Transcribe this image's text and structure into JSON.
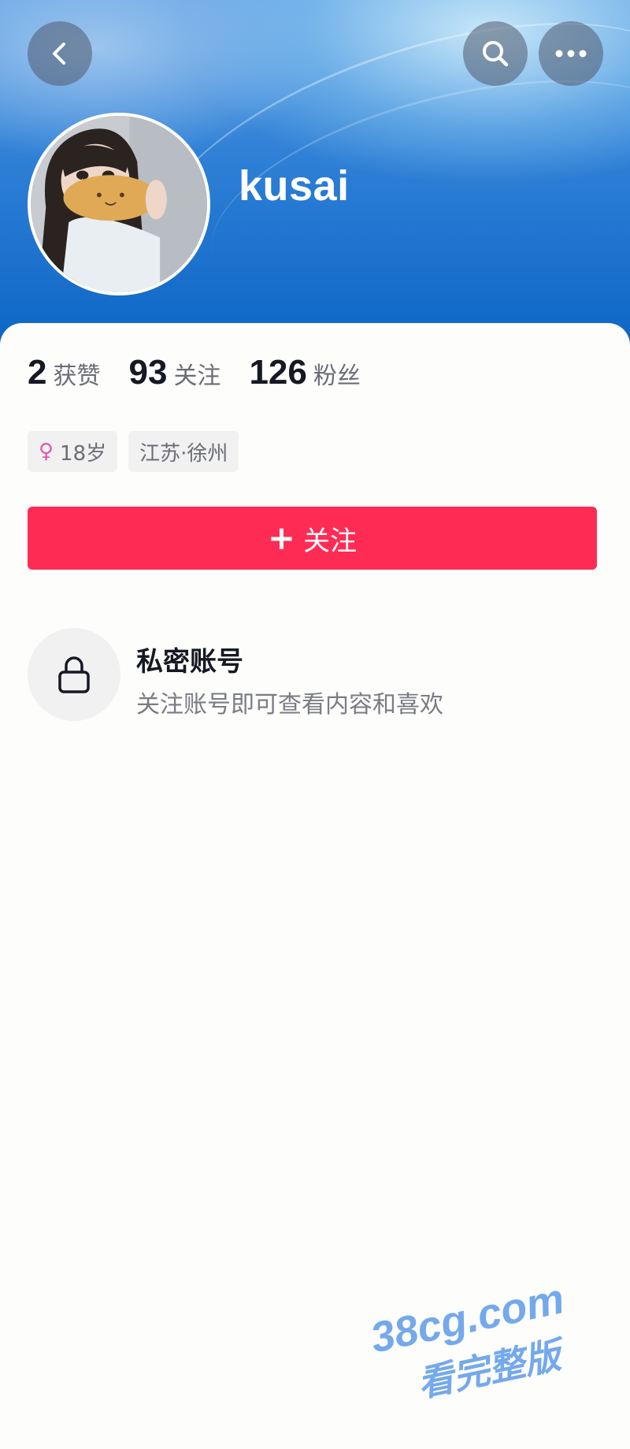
{
  "header": {
    "back_icon": "chevron-left-icon",
    "search_icon": "search-icon",
    "more_icon": "more-horizontal-icon",
    "username": "kusai"
  },
  "stats": [
    {
      "value": "2",
      "label": "获赞"
    },
    {
      "value": "93",
      "label": "关注"
    },
    {
      "value": "126",
      "label": "粉丝"
    }
  ],
  "tags": {
    "gender_icon": "female-icon",
    "gender_symbol": "♀",
    "age": "18岁",
    "location": "江苏·徐州"
  },
  "follow_button": {
    "plus": "+",
    "label": "关注"
  },
  "private_account": {
    "icon": "lock-icon",
    "title": "私密账号",
    "description": "关注账号即可查看内容和喜欢"
  },
  "watermark": {
    "line1": "38cg.com",
    "line2": "看完整版"
  },
  "colors": {
    "accent": "#fe2c55",
    "header_blue": "#0d66c6",
    "text_primary": "#161823",
    "text_secondary": "#6b6d75",
    "tag_bg": "#f1f1f2"
  }
}
